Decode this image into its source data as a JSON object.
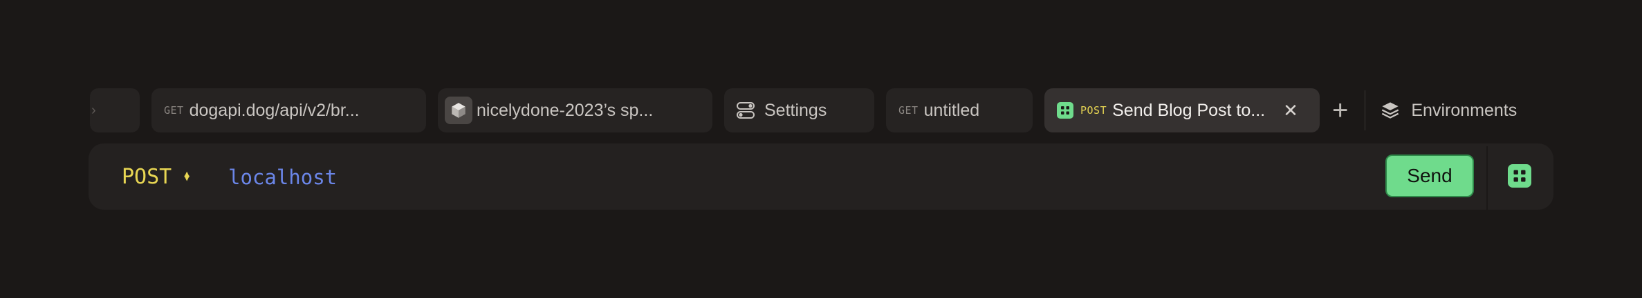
{
  "tabs": [
    {
      "id": "partial",
      "method": "",
      "label": ""
    },
    {
      "id": "dogapi",
      "method": "GET",
      "label": "dogapi.dog/api/v2/br..."
    },
    {
      "id": "nicely",
      "method": "",
      "label": "nicelydone-2023’s sp...",
      "icon": "package-icon"
    },
    {
      "id": "settings",
      "method": "",
      "label": "Settings",
      "icon": "toggle-settings-icon"
    },
    {
      "id": "untitled",
      "method": "GET",
      "label": "untitled"
    },
    {
      "id": "blog",
      "method": "POST",
      "label": "Send Blog Post to...",
      "icon": "grid-app-icon",
      "active": true
    }
  ],
  "add_tab_label": "+",
  "environments_label": "Environments",
  "request": {
    "method": "POST",
    "url": "localhost",
    "send_label": "Send"
  },
  "colors": {
    "background": "#1b1817",
    "post_method": "#e8d653",
    "url_text": "#6b86e8",
    "send_button": "#6fdb8c"
  }
}
